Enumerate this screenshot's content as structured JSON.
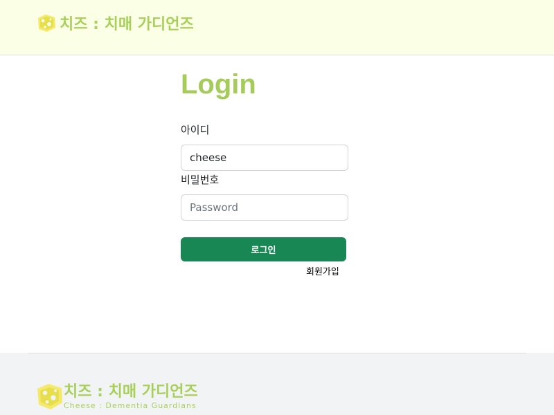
{
  "header": {
    "brand_text": "치즈 : 치매 가디언즈",
    "logo_icon": "cheese-logo-icon"
  },
  "login": {
    "title": "Login",
    "id_label": "아이디",
    "id_value": "cheese",
    "password_label": "비밀번호",
    "password_placeholder": "Password",
    "login_button": "로그인",
    "signup_link": "회원가입"
  },
  "footer": {
    "brand_text": "치즈 : 치매 가디언즈",
    "brand_subtitle": "Cheese : Dementia Guardians",
    "logo_icon": "cheese-logo-icon"
  },
  "colors": {
    "header_bg": "#fbffe6",
    "brand_green": "#a9cf5b",
    "button_green": "#198754",
    "footer_bg": "#f2f3f5"
  }
}
